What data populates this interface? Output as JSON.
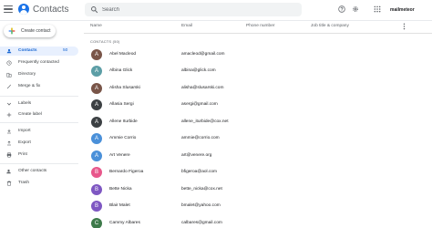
{
  "header": {
    "app_title": "Contacts",
    "search_placeholder": "Search",
    "account_name": "mailmeteor"
  },
  "sidebar": {
    "create_label": "Create contact",
    "items": [
      {
        "label": "Contacts",
        "count": "50",
        "icon": "person-icon",
        "active": true
      },
      {
        "label": "Frequently contacted",
        "icon": "history-icon"
      },
      {
        "label": "Directory",
        "icon": "domain-icon"
      },
      {
        "label": "Merge & fix",
        "icon": "auto-fix-icon"
      }
    ],
    "labels_heading": "Labels",
    "create_label_label": "Create label",
    "tools": [
      {
        "label": "Import",
        "icon": "import-icon"
      },
      {
        "label": "Export",
        "icon": "export-icon"
      },
      {
        "label": "Print",
        "icon": "print-icon"
      }
    ],
    "bottom": [
      {
        "label": "Other contacts",
        "icon": "person-add-icon"
      },
      {
        "label": "Trash",
        "icon": "trash-icon"
      }
    ]
  },
  "list": {
    "columns": {
      "name": "Name",
      "email": "Email",
      "phone": "Phone number",
      "job": "Job title & company"
    },
    "section_label": "CONTACTS (50)",
    "rows": [
      {
        "initial": "A",
        "name": "Abel Macleod",
        "email": "amacleod@gmail.com",
        "color": "#795548"
      },
      {
        "initial": "A",
        "name": "Albina Glick",
        "email": "albina@glick.com",
        "color": "#5c9ea6"
      },
      {
        "initial": "A",
        "name": "Alisha Slusarski",
        "email": "alisha@slusarski.com",
        "color": "#795548"
      },
      {
        "initial": "A",
        "name": "Allasia Sergi",
        "email": "asergi@gmail.com",
        "color": "#3c4043"
      },
      {
        "initial": "A",
        "name": "Allene Iturbide",
        "email": "allene_iturbide@cox.net",
        "color": "#3c4043"
      },
      {
        "initial": "A",
        "name": "Ammie Corrio",
        "email": "ammie@corrio.com",
        "color": "#4a90d9"
      },
      {
        "initial": "A",
        "name": "Art Venere",
        "email": "art@venere.org",
        "color": "#4a90d9"
      },
      {
        "initial": "B",
        "name": "Bernardo Figeroa",
        "email": "bfigeroa@aol.com",
        "color": "#e8578b"
      },
      {
        "initial": "B",
        "name": "Bette Nicka",
        "email": "bette_nicka@cox.net",
        "color": "#7e57c2"
      },
      {
        "initial": "B",
        "name": "Blair Malet",
        "email": "bmalet@yahoo.com",
        "color": "#7e57c2"
      },
      {
        "initial": "C",
        "name": "Cammy Albares",
        "email": "calbares@gmail.com",
        "color": "#3d7a4a"
      }
    ]
  }
}
